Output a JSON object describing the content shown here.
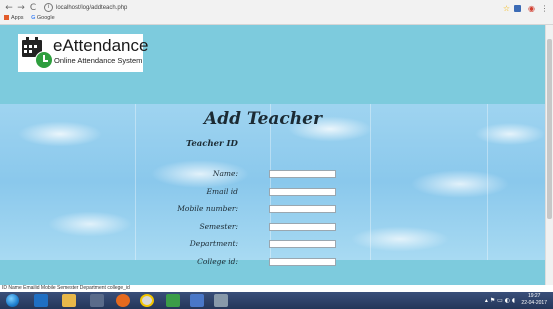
{
  "browser": {
    "back_icon": "←",
    "forward_icon": "→",
    "reload_icon": "C",
    "info_icon": "i",
    "url": "localhost/log/addteach.php",
    "bookmarks": {
      "apps": "Apps",
      "google": "Google"
    },
    "menu_icon": "⋮"
  },
  "logo": {
    "title": "eAttendance",
    "subtitle": "Online Attendance System"
  },
  "form": {
    "title": "Add Teacher",
    "teacher_id_label": "Teacher ID",
    "fields": [
      {
        "label": "Name:",
        "value": ""
      },
      {
        "label": "Email id",
        "value": ""
      },
      {
        "label": "Mobile number:",
        "value": ""
      },
      {
        "label": "Semester:",
        "value": ""
      },
      {
        "label": "Department:",
        "value": ""
      },
      {
        "label": "College id:",
        "value": ""
      }
    ]
  },
  "status_text": "ID Name Emailid Mobile Semester Department college_id",
  "taskbar": {
    "tray_icons": "▴ ⚑ ▭ ◐ ◖",
    "time": "19:27",
    "date": "22-04-2017"
  },
  "colors": {
    "header_bg": "#7dcbdd",
    "taskbar_bg": "#243659"
  }
}
